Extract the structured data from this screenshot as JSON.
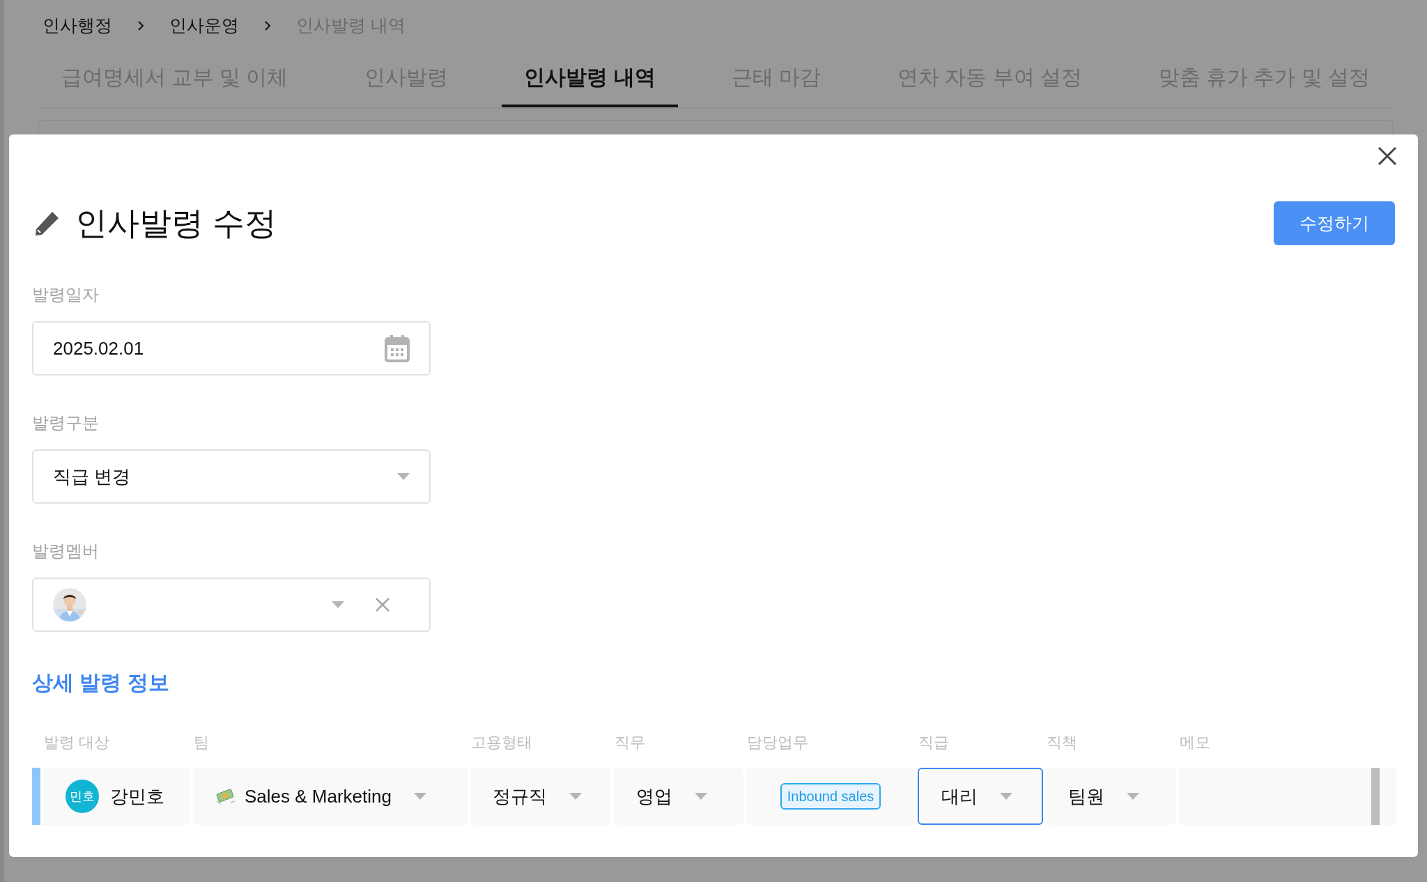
{
  "breadcrumb": [
    {
      "label": "인사행정",
      "current": false
    },
    {
      "label": "인사운영",
      "current": false
    },
    {
      "label": "인사발령 내역",
      "current": true
    }
  ],
  "tabs": [
    {
      "label": "급여명세서 교부 및 이체",
      "selected": false
    },
    {
      "label": "인사발령",
      "selected": false
    },
    {
      "label": "인사발령 내역",
      "selected": true
    },
    {
      "label": "근태 마감",
      "selected": false
    },
    {
      "label": "연차 자동 부여 설정",
      "selected": false
    },
    {
      "label": "맞춤 휴가 추가 및 설정",
      "selected": false
    }
  ],
  "modal": {
    "title": "인사발령 수정",
    "submit_button": "수정하기",
    "fields": [
      {
        "kind": "date",
        "label": "발령일자",
        "value": "2025.02.01"
      },
      {
        "kind": "select",
        "label": "발령구분",
        "value": "직급 변경"
      },
      {
        "kind": "member",
        "label": "발령멤버"
      }
    ],
    "section_title": "상세 발령 정보",
    "table": {
      "columns": [
        "발령 대상",
        "팀",
        "고용형태",
        "직무",
        "담당업무",
        "직급",
        "직책",
        "메모"
      ],
      "rows": [
        {
          "cells": [
            {
              "kind": "member",
              "initials": "민호",
              "name": "강민호"
            },
            {
              "kind": "team",
              "value": "Sales & Marketing",
              "focused": false
            },
            {
              "kind": "select",
              "value": "정규직",
              "focused": false
            },
            {
              "kind": "select",
              "value": "영업",
              "focused": false
            },
            {
              "kind": "tag",
              "value": "Inbound sales"
            },
            {
              "kind": "select",
              "value": "대리",
              "focused": true
            },
            {
              "kind": "select",
              "value": "팀원",
              "focused": false
            },
            {
              "kind": "empty"
            }
          ]
        }
      ]
    }
  }
}
